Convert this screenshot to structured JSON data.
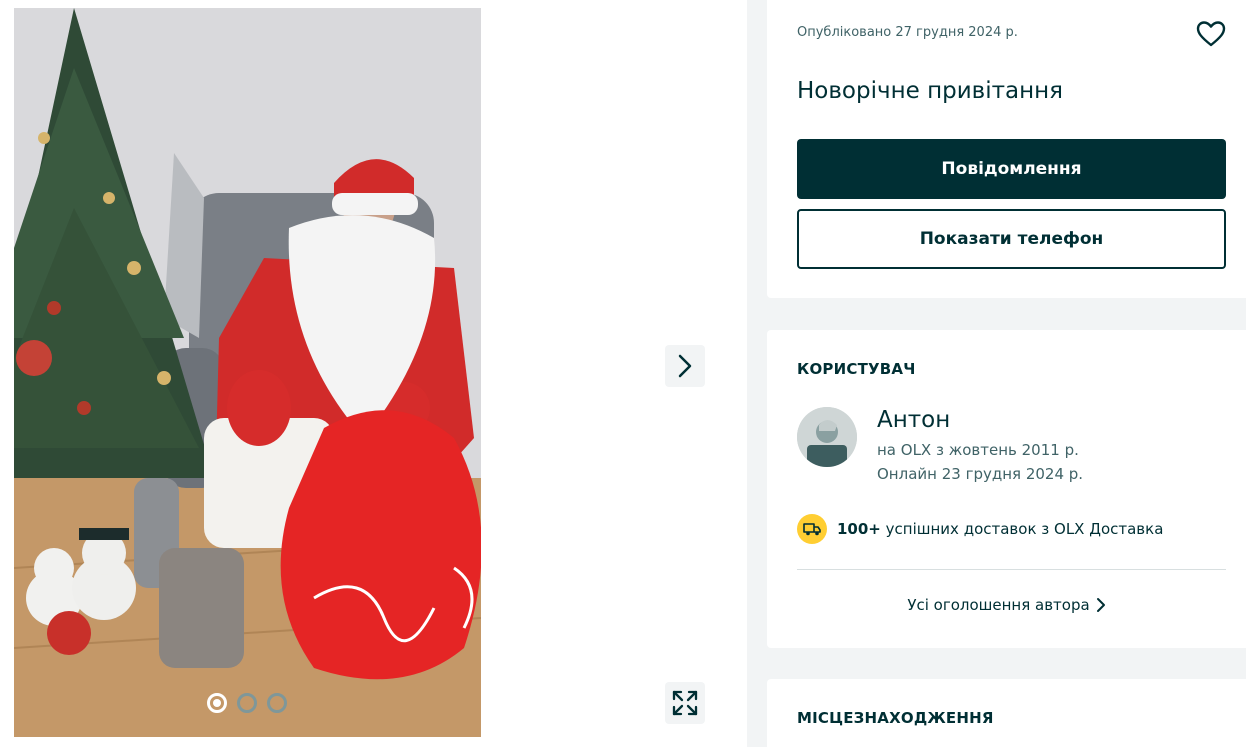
{
  "gallery": {
    "photo_alt": "",
    "slide_count": 3,
    "active_slide": 1
  },
  "ad": {
    "posted": "Опубліковано 27 грудня 2024 р.",
    "title": "Новорічне привітання",
    "message_button": "Повідомлення",
    "phone_button": "Показати телефон"
  },
  "user": {
    "heading": "КОРИСТУВАЧ",
    "name": "Антон",
    "since": "на OLX з жовтень 2011 р.",
    "online": "Онлайн 23 грудня 2024 р.",
    "delivery_count": "100+",
    "delivery_text": "успішних доставок з OLX Доставка",
    "all_ads_link": "Усі оголошення автора"
  },
  "location": {
    "heading": "МІСЦЕЗНАХОДЖЕННЯ"
  },
  "colors": {
    "primary": "#002f34",
    "secondary_text": "#406367",
    "delivery_badge": "#ffce32",
    "background": "#f2f4f5"
  },
  "icons": {
    "favorite": "heart-icon",
    "next": "chevron-right-icon",
    "fullscreen": "expand-icon",
    "delivery": "truck-icon",
    "link_arrow": "chevron-right-icon"
  }
}
